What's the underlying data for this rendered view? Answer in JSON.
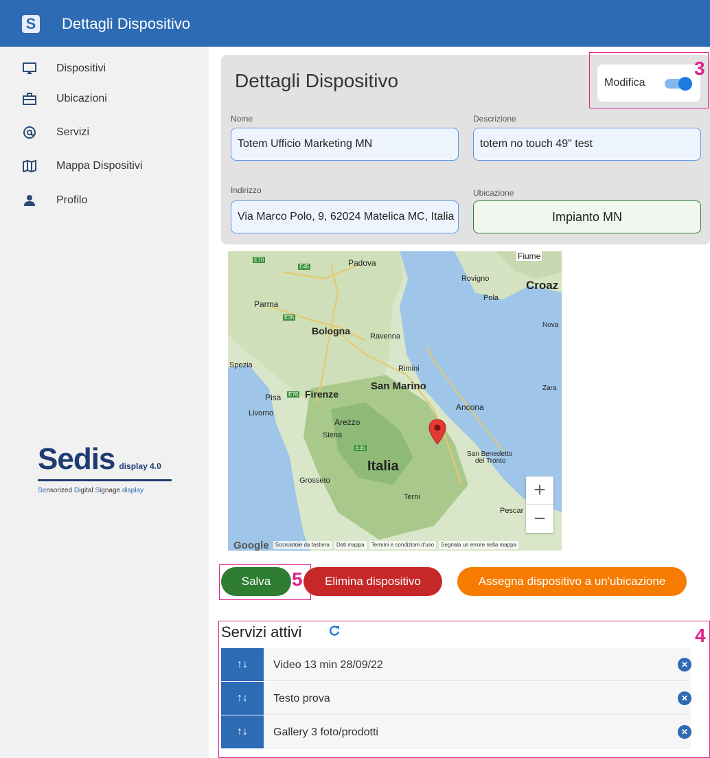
{
  "app": {
    "title": "Dettagli Dispositivo",
    "logo_letter": "S"
  },
  "sidebar": {
    "items": [
      {
        "label": "Dispositivi",
        "icon": "monitor-icon"
      },
      {
        "label": "Ubicazioni",
        "icon": "briefcase-icon"
      },
      {
        "label": "Servizi",
        "icon": "at-icon"
      },
      {
        "label": "Mappa Dispositivi",
        "icon": "map-icon"
      },
      {
        "label": "Profilo",
        "icon": "person-icon"
      }
    ],
    "brand": {
      "name": "Sedis",
      "version": "display 4.0",
      "tagline_parts": [
        "Se",
        "nsorized ",
        "Di",
        "gital ",
        "S",
        "ignage ",
        "display"
      ]
    }
  },
  "card": {
    "title": "Dettagli Dispositivo",
    "modifica_label": "Modifica",
    "modifica_on": true,
    "fields": {
      "nome": {
        "label": "Nome",
        "value": "Totem Ufficio Marketing MN"
      },
      "descrizione": {
        "label": "Descrizione",
        "value": "totem no touch 49\" test"
      },
      "indirizzo": {
        "label": "Indirizzo",
        "value": "Via Marco Polo, 9, 62024 Matelica MC, Italia"
      },
      "ubicazione": {
        "label": "Ubicazione",
        "value": "Impianto MN"
      }
    }
  },
  "map": {
    "labels": {
      "padova": "Padova",
      "parma": "Parma",
      "bologna": "Bologna",
      "ravenna": "Ravenna",
      "rimini": "Rimini",
      "san_marino": "San Marino",
      "spezia": "Spezia",
      "pisa": "Pisa",
      "firenze": "Firenze",
      "livorno": "Livorno",
      "arezzo": "Arezzo",
      "siena": "Siena",
      "ancona": "Ancona",
      "italia": "Italia",
      "grosseto": "Grosseto",
      "terni": "Terni",
      "pescara": "Pescar",
      "san_benedetto_1": "San Benedetto",
      "san_benedetto_2": "del Tronto",
      "fiume": "Fiume",
      "rovigno": "Rovigno",
      "pola": "Pola",
      "croazia": "Croaz",
      "novalja": "Nova",
      "zara": "Zara",
      "e70": "E70",
      "e45": "E45",
      "e35a": "E35",
      "e76": "E76",
      "e35b": "E35"
    },
    "zoom_in": "+",
    "zoom_out": "−",
    "google": "Google",
    "footer": [
      "Scorciatoie da tastiera",
      "Dati mappa",
      "Termini e condizioni d'uso",
      "Segnala un errore nella mappa"
    ]
  },
  "actions": {
    "salva": "Salva",
    "elimina": "Elimina dispositivo",
    "assegna": "Assegna dispositivo a un'ubicazione"
  },
  "annotations": {
    "a3": "3",
    "a4": "4",
    "a5": "5"
  },
  "services": {
    "title": "Servizi attivi",
    "handle_glyph": "↑↓",
    "delete_glyph": "✕",
    "items": [
      {
        "label": "Video 13 min 28/09/22"
      },
      {
        "label": "Testo prova"
      },
      {
        "label": "Gallery 3 foto/prodotti"
      }
    ]
  },
  "colors": {
    "primary": "#2d6bb5",
    "salva": "#2e7d32",
    "elimina": "#c62828",
    "assegna": "#f57c00",
    "annotation": "#e0228a"
  }
}
